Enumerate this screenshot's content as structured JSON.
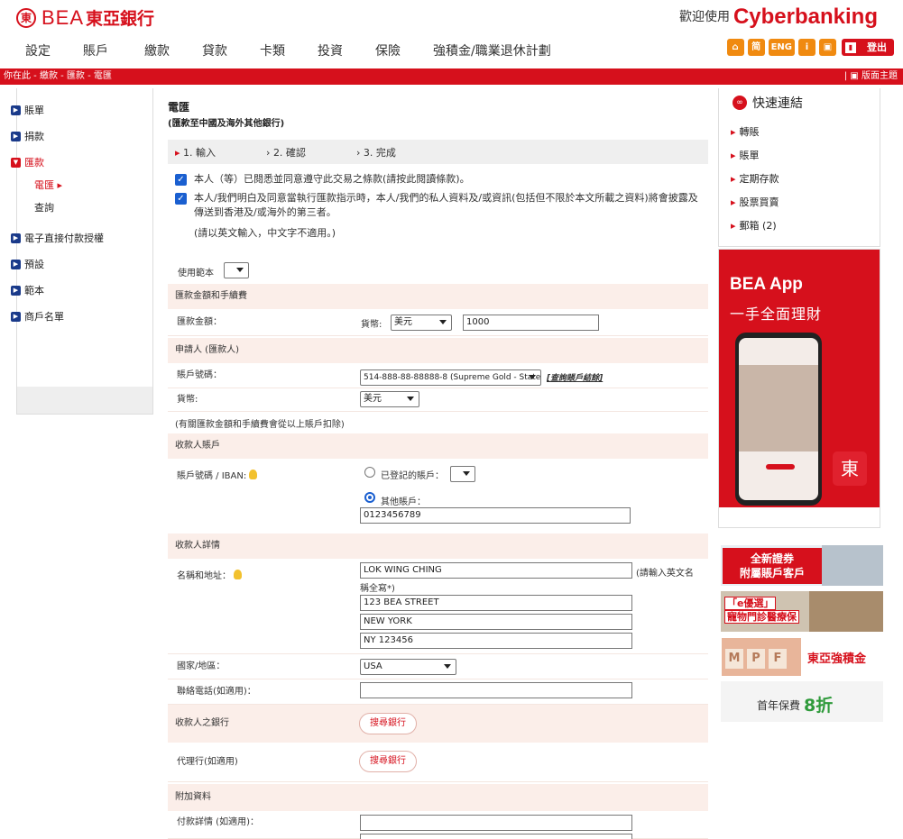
{
  "header": {
    "logo_en": "BEA",
    "logo_cn": "東亞銀行",
    "welcome": "歡迎使用",
    "brand": "Cyberbanking"
  },
  "menu": [
    "設定",
    "賬戶",
    "繳款",
    "貸款",
    "卡類",
    "投資",
    "保險",
    "強積金/職業退休計劃"
  ],
  "toolbar": {
    "home_icon": "home-icon",
    "simplified": "简",
    "english": "ENG",
    "info": "i",
    "settings_icon": "settings-icon",
    "logout": "登出"
  },
  "breadcrumb": "你在此 - 繳款 - 匯款 - 電匯",
  "layout_toggle": "版面主題",
  "sidebar": {
    "items": [
      {
        "label": "賬單"
      },
      {
        "label": "捐款"
      },
      {
        "label": "匯款"
      },
      {
        "label": "電子直接付款授權"
      },
      {
        "label": "預設"
      },
      {
        "label": "範本"
      },
      {
        "label": "商戶名單"
      }
    ],
    "sub": [
      {
        "label": "電匯 ▸"
      },
      {
        "label": "查詢"
      }
    ]
  },
  "page": {
    "title": "電匯",
    "subtitle": "(匯款至中國及海外其他銀行)",
    "steps": [
      "1. 輸入",
      "2. 確認",
      "3. 完成"
    ],
    "check1": "本人（等）已閱悉並同意遵守此交易之條款(請按此閱讀條款)。",
    "check2": "本人/我們明白及同意當執行匯款指示時，本人/我們的私人資料及/或資訊(包括但不限於本文所載之資料)將會披露及傳送到香港及/或海外的第三者。",
    "note": "(請以英文輸入，中文字不適用。)",
    "template_label": "使用範本"
  },
  "form": {
    "sec_amount": "匯款金額和手續費",
    "amount_label": "匯款金額：",
    "currency_label": "貨幣:",
    "currency": "美元",
    "amount": "1000",
    "sec_applicant": "申請人 (匯款人)",
    "acct_label": "賬戶號碼：",
    "acct_value": "514-888-88-88888-8 (Supreme Gold - State",
    "acct_link": "[查詢賬戶結餘]",
    "applicant_currency_label": "貨幣:",
    "applicant_currency": "美元",
    "deduct_note": "(有關匯款金額和手續費會從以上賬戶扣除)",
    "sec_beneficiary_acct": "收款人賬戶",
    "iban_label": "賬戶號碼 / IBAN:",
    "registered": "已登記的賬戶：",
    "other_acct": "其他賬戶：",
    "other_acct_value": "0123456789",
    "sec_beneficiary": "收款人詳情",
    "name_label": "名稱和地址：",
    "name": "LOK WING CHING",
    "name_hint": "(請輸入英文名稱全寫*)",
    "addr1": "123 BEA STREET",
    "addr2": "NEW YORK",
    "addr3": "NY 123456",
    "country_label": "國家/地區：",
    "country": "USA",
    "phone_label": "聯絡電話(如適用)：",
    "phone": "",
    "bank_label": "收款人之銀行",
    "bank_button": "搜尋銀行",
    "agent_label": "代理行(如適用)",
    "agent_button": "搜尋銀行",
    "sec_additional": "附加資料",
    "payment_detail_label": "付款詳情 (如適用)："
  },
  "right": {
    "quick_links": "快速連結",
    "links": [
      "轉賬",
      "賬單",
      "定期存款",
      "股票買賣",
      "郵箱 (2)"
    ],
    "app_title": "BEA App",
    "app_subtitle": "一手全面理財",
    "ad1": "全新證券\n附屬賬戶客戶",
    "ad2a": "「e優選」",
    "ad2b": "寵物門診醫療保",
    "ad3_letters": [
      "M",
      "P",
      "F"
    ],
    "ad3": "東亞強積金",
    "ad4": "首年保費",
    "ad4_num": "8折"
  }
}
